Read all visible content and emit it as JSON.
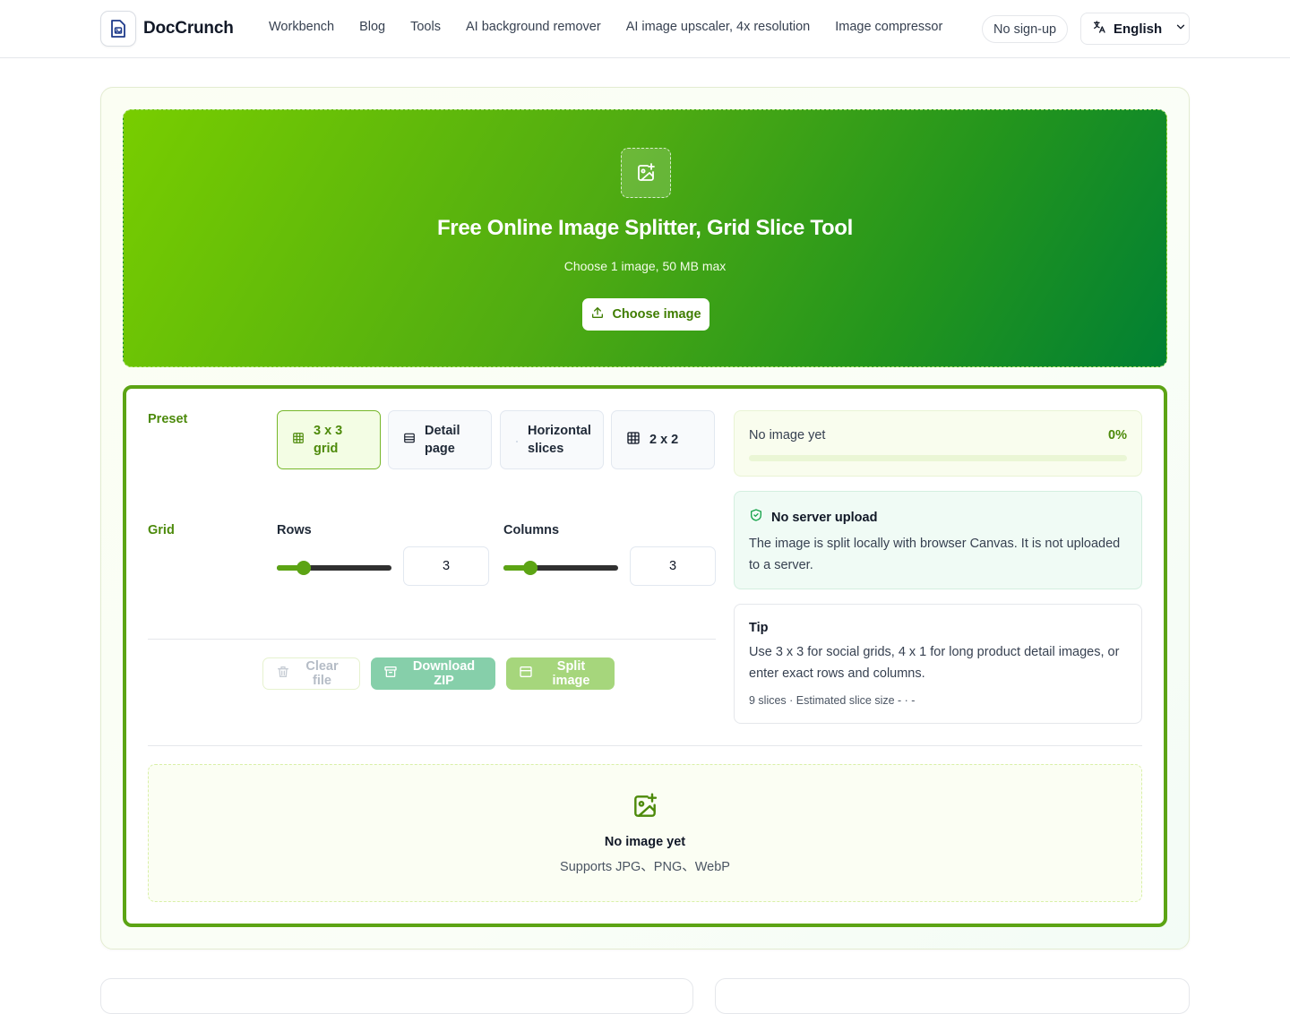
{
  "header": {
    "brand": "DocCrunch",
    "nav": [
      "Workbench",
      "Blog",
      "Tools",
      "AI background remover",
      "AI image upscaler, 4x resolution",
      "Image compressor"
    ],
    "badge": "No sign-up",
    "language": "English"
  },
  "hero": {
    "title": "Free Online Image Splitter, Grid Slice Tool",
    "subtitle": "Choose 1 image, 50 MB max",
    "choose_button": "Choose image"
  },
  "settings": {
    "preset_label": "Preset",
    "presets": [
      {
        "label": "3 x 3 grid",
        "icon": "grid-icon",
        "active": true
      },
      {
        "label": "Detail page",
        "icon": "rows-icon",
        "active": false
      },
      {
        "label": "Horizontal slices",
        "icon": "dot-icon",
        "active": false
      },
      {
        "label": "2 x 2",
        "icon": "grid-icon",
        "active": false
      }
    ],
    "grid_label": "Grid",
    "rows": {
      "label": "Rows",
      "value": "3",
      "min": 1,
      "max": 10
    },
    "columns": {
      "label": "Columns",
      "value": "3",
      "min": 1,
      "max": 10
    },
    "buttons": {
      "clear": "Clear file",
      "download": "Download ZIP",
      "split": "Split image"
    }
  },
  "status": {
    "text": "No image yet",
    "percent_label": "0%",
    "progress": 0
  },
  "secure": {
    "title": "No server upload",
    "body": "The image is split locally with browser Canvas. It is not uploaded to a server."
  },
  "tip": {
    "title": "Tip",
    "body": "Use 3 x 3 for social grids, 4 x 1 for long product detail images, or enter exact rows and columns.",
    "meta": "9 slices · Estimated slice size - · -"
  },
  "preview": {
    "title": "No image yet",
    "subtitle": "Supports JPG、PNG、WebP"
  },
  "colors": {
    "accent": "#5ca414",
    "hero_start": "#78cd00",
    "hero_end": "#018033"
  }
}
